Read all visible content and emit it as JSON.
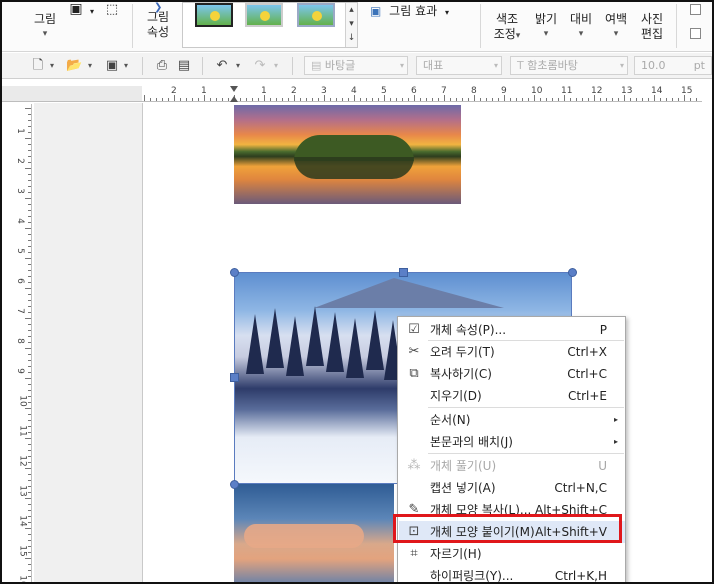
{
  "ribbon": {
    "image_label": "그림",
    "image_props_label_1": "그림",
    "image_props_label_2": "속성",
    "image_effect_label": "그림 효과",
    "color_tone_1": "색조",
    "color_tone_2": "조정",
    "brightness": "밝기",
    "contrast": "대비",
    "margin": "여백",
    "photo_edit_1": "사진",
    "photo_edit_2": "편집"
  },
  "toolbar": {
    "style_combo": "바탕글",
    "lang_combo": "대표",
    "font_combo": "함초롬바탕",
    "size_value": "10.0",
    "size_unit": "pt"
  },
  "ruler": {
    "corner": "L",
    "h_numbers": [
      "2",
      "1",
      "1",
      "2",
      "3",
      "4",
      "5",
      "6",
      "7",
      "8",
      "9",
      "10",
      "11",
      "12",
      "13",
      "14",
      "15"
    ],
    "v_numbers": [
      "1",
      "2",
      "3",
      "4",
      "5",
      "6",
      "7",
      "8",
      "9",
      "10",
      "11",
      "12",
      "13",
      "14",
      "15",
      "16"
    ]
  },
  "context_menu": {
    "items": [
      {
        "label": "개체 속성(P)...",
        "shortcut": "P",
        "icon": "properties-icon",
        "state": "normal"
      },
      {
        "label": "오려 두기(T)",
        "shortcut": "Ctrl+X",
        "icon": "scissors-icon",
        "state": "normal"
      },
      {
        "label": "복사하기(C)",
        "shortcut": "Ctrl+C",
        "icon": "copy-icon",
        "state": "normal"
      },
      {
        "label": "지우기(D)",
        "shortcut": "Ctrl+E",
        "icon": "",
        "state": "normal"
      },
      {
        "label": "순서(N)",
        "shortcut": "",
        "icon": "",
        "state": "submenu"
      },
      {
        "label": "본문과의 배치(J)",
        "shortcut": "",
        "icon": "",
        "state": "submenu"
      },
      {
        "label": "개체 풀기(U)",
        "shortcut": "U",
        "icon": "ungroup-icon",
        "state": "disabled"
      },
      {
        "label": "캡션 넣기(A)",
        "shortcut": "Ctrl+N,C",
        "icon": "",
        "state": "normal"
      },
      {
        "label": "개체 모양 복사(L)...",
        "shortcut": "Alt+Shift+C",
        "icon": "copy-shape-icon",
        "state": "normal"
      },
      {
        "label": "개체 모양 붙이기(M)",
        "shortcut": "Alt+Shift+V",
        "icon": "paste-shape-icon",
        "state": "highlighted"
      },
      {
        "label": "자르기(H)",
        "shortcut": "",
        "icon": "crop-icon",
        "state": "normal"
      },
      {
        "label": "하이퍼링크(Y)...",
        "shortcut": "Ctrl+K,H",
        "icon": "",
        "state": "normal"
      }
    ]
  },
  "colors": {
    "highlight_box": "#e0171b",
    "selection": "#5b7fc7",
    "menu_highlight": "#dfe8f7"
  }
}
